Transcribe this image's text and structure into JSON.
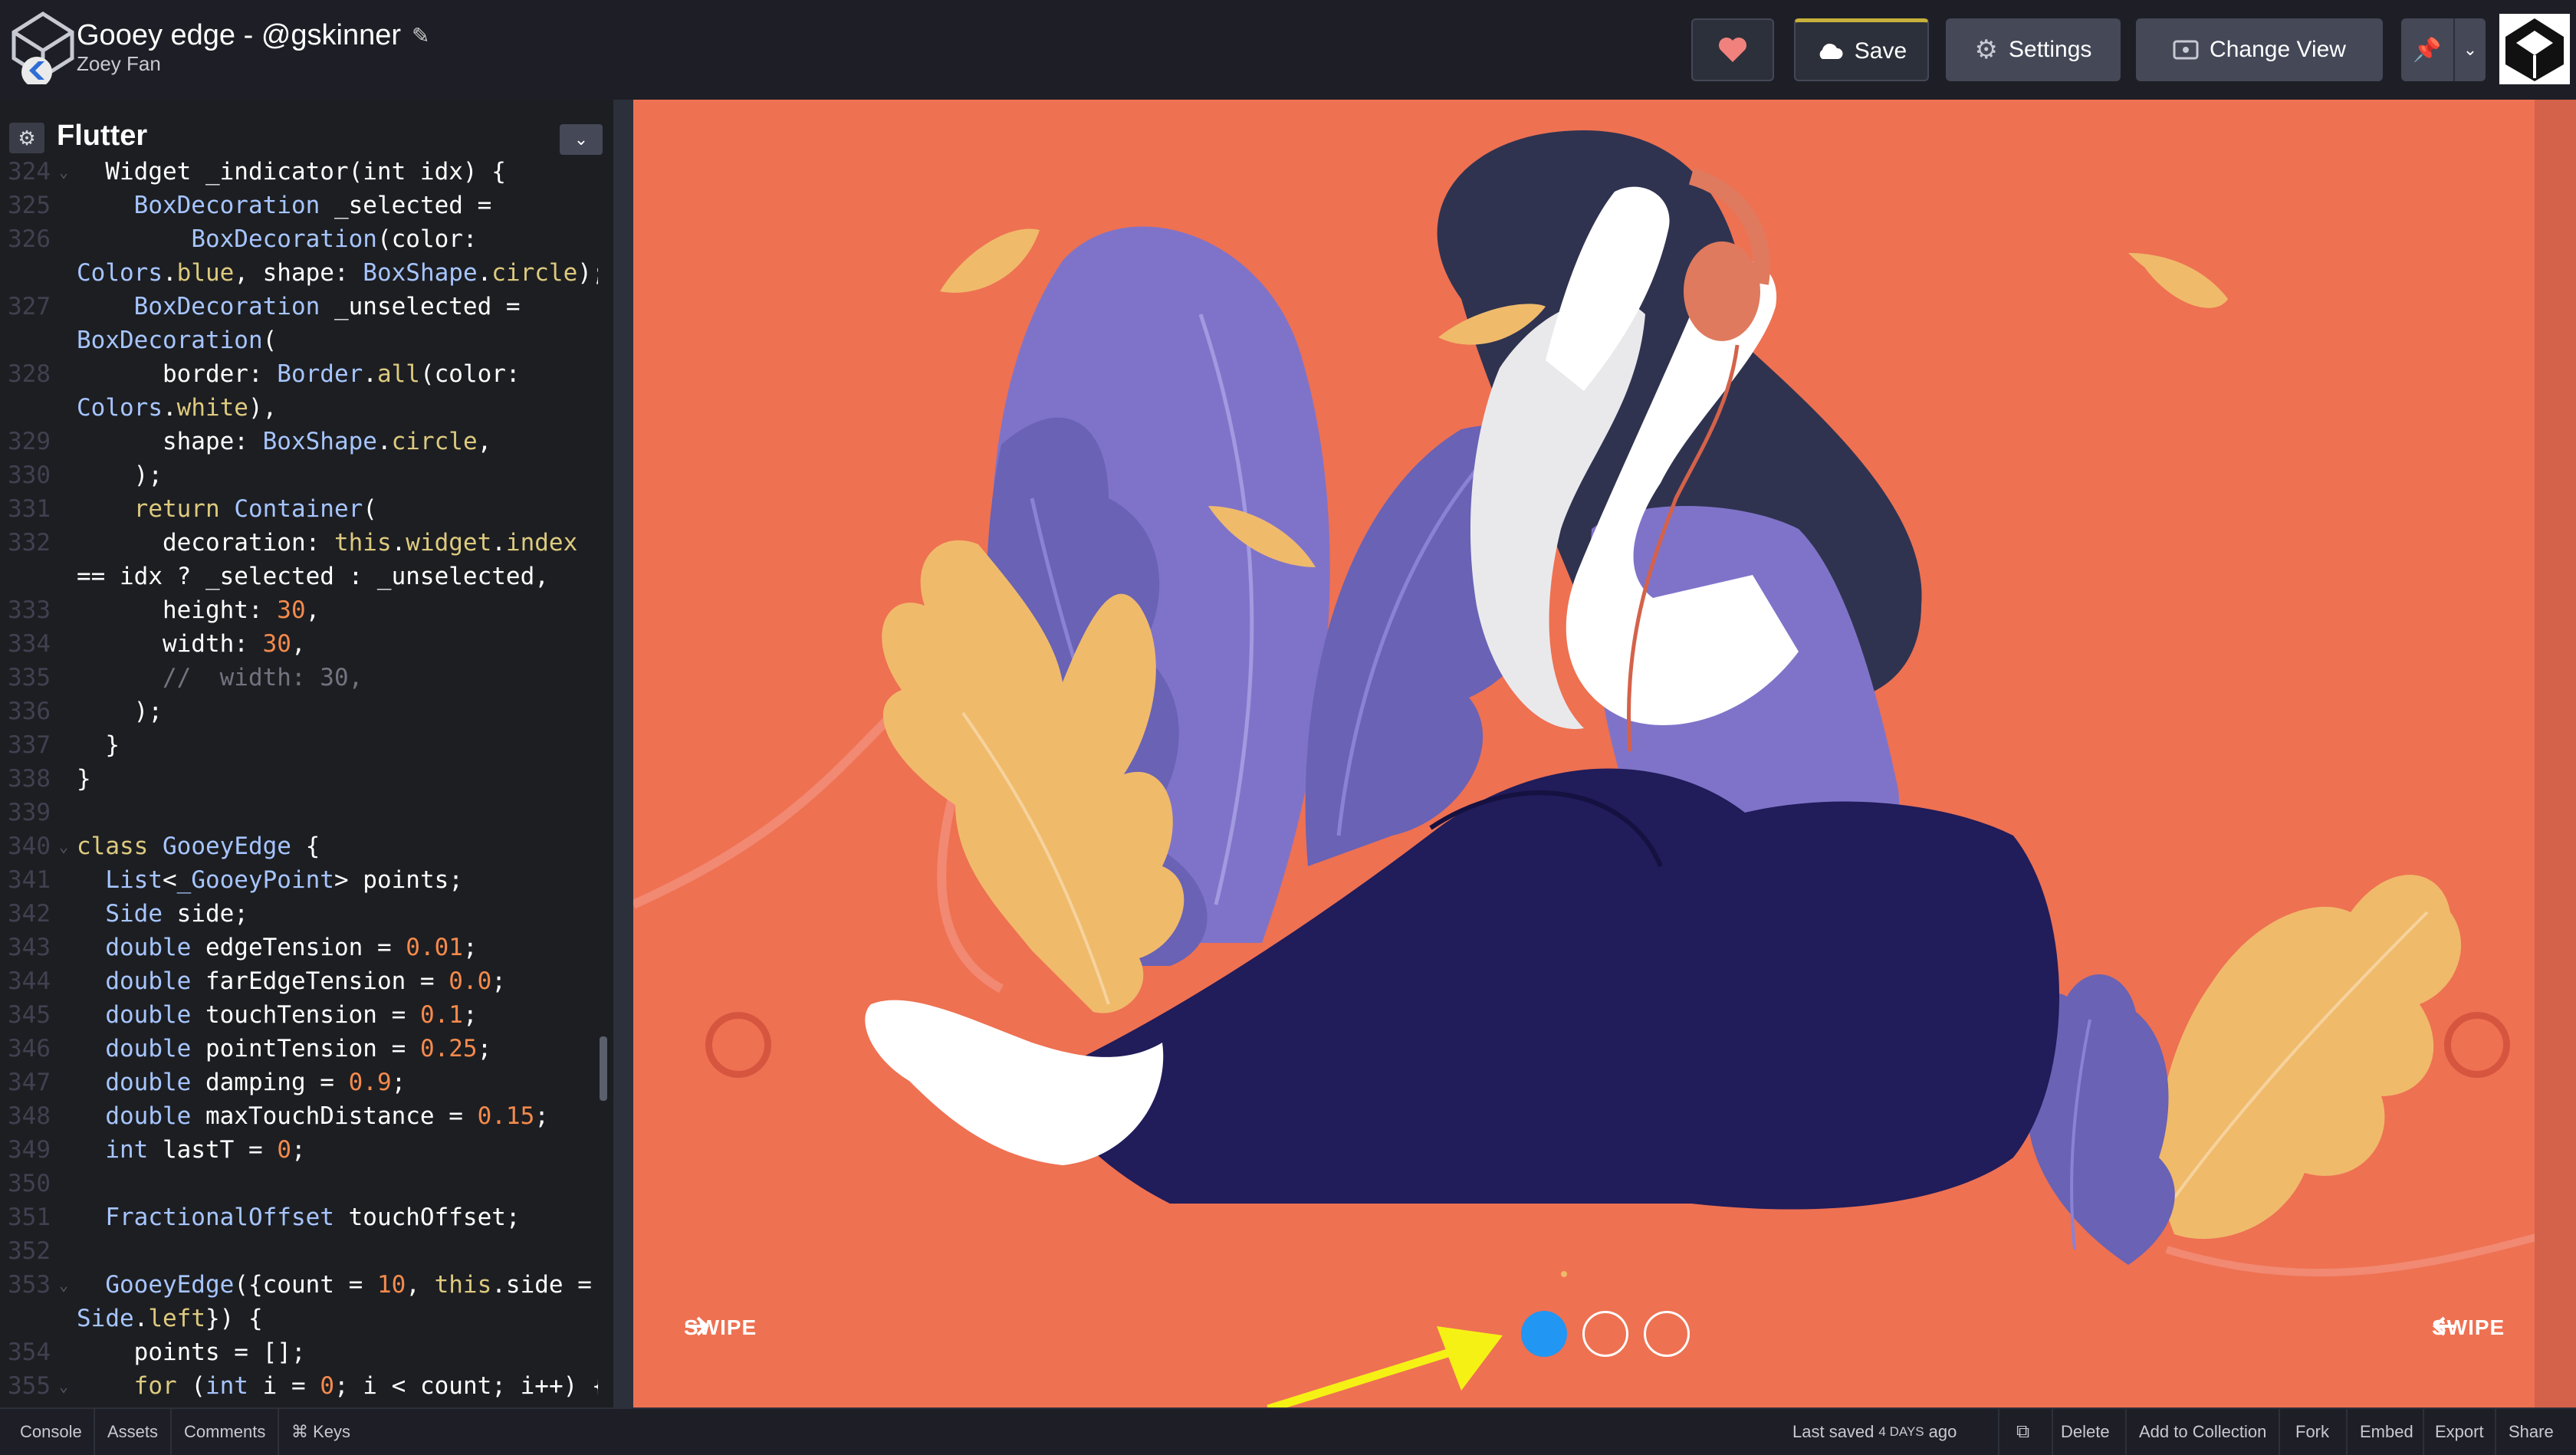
{
  "header": {
    "pen_title": "Gooey edge - @gskinner",
    "author": "Zoey Fan",
    "save_label": "Save",
    "settings_label": "Settings",
    "change_view_label": "Change View"
  },
  "editor": {
    "language": "Flutter",
    "lines": [
      {
        "n": "324",
        "fold": true,
        "parts": [
          [
            "",
            "  Widget _indicator(int idx) {"
          ]
        ]
      },
      {
        "n": "325",
        "parts": [
          [
            "",
            "    "
          ],
          [
            "t",
            "BoxDecoration"
          ],
          [
            "",
            " _selected ="
          ]
        ]
      },
      {
        "n": "326",
        "parts": [
          [
            "",
            "        "
          ],
          [
            "t",
            "BoxDecoration"
          ],
          [
            "",
            "(color:"
          ]
        ]
      },
      {
        "n": "",
        "parts": [
          [
            "t",
            "Colors"
          ],
          [
            "",
            "."
          ],
          [
            "k",
            "blue"
          ],
          [
            "",
            ", shape: "
          ],
          [
            "t",
            "BoxShape"
          ],
          [
            "",
            "."
          ],
          [
            "k",
            "circle"
          ],
          [
            "",
            ");"
          ]
        ]
      },
      {
        "n": "327",
        "parts": [
          [
            "",
            "    "
          ],
          [
            "t",
            "BoxDecoration"
          ],
          [
            "",
            " _unselected ="
          ]
        ]
      },
      {
        "n": "",
        "parts": [
          [
            "t",
            "BoxDecoration"
          ],
          [
            "",
            "("
          ]
        ]
      },
      {
        "n": "328",
        "parts": [
          [
            "",
            "      border: "
          ],
          [
            "t",
            "Border"
          ],
          [
            "",
            "."
          ],
          [
            "k",
            "all"
          ],
          [
            "",
            "(color:"
          ]
        ]
      },
      {
        "n": "",
        "parts": [
          [
            "t",
            "Colors"
          ],
          [
            "",
            "."
          ],
          [
            "k",
            "white"
          ],
          [
            "",
            "),"
          ]
        ]
      },
      {
        "n": "329",
        "parts": [
          [
            "",
            "      shape: "
          ],
          [
            "t",
            "BoxShape"
          ],
          [
            "",
            "."
          ],
          [
            "k",
            "circle"
          ],
          [
            "",
            ","
          ]
        ]
      },
      {
        "n": "330",
        "parts": [
          [
            "",
            "    );"
          ]
        ]
      },
      {
        "n": "331",
        "parts": [
          [
            "",
            "    "
          ],
          [
            "k",
            "return"
          ],
          [
            "",
            " "
          ],
          [
            "t",
            "Container"
          ],
          [
            "",
            "("
          ]
        ]
      },
      {
        "n": "332",
        "parts": [
          [
            "",
            "      decoration: "
          ],
          [
            "k",
            "this"
          ],
          [
            "",
            "."
          ],
          [
            "k",
            "widget"
          ],
          [
            "",
            "."
          ],
          [
            "k",
            "index"
          ]
        ]
      },
      {
        "n": "",
        "parts": [
          [
            "",
            "== idx ? _selected : _unselected,"
          ]
        ]
      },
      {
        "n": "333",
        "parts": [
          [
            "",
            "      height: "
          ],
          [
            "n",
            "30"
          ],
          [
            "",
            ","
          ]
        ]
      },
      {
        "n": "334",
        "parts": [
          [
            "",
            "      width: "
          ],
          [
            "n",
            "30"
          ],
          [
            "",
            ","
          ]
        ]
      },
      {
        "n": "335",
        "parts": [
          [
            "c",
            "      //  width: 30,"
          ]
        ]
      },
      {
        "n": "336",
        "parts": [
          [
            "",
            "    );"
          ]
        ]
      },
      {
        "n": "337",
        "parts": [
          [
            "",
            "  }"
          ]
        ]
      },
      {
        "n": "338",
        "parts": [
          [
            "",
            "}"
          ]
        ]
      },
      {
        "n": "339",
        "parts": [
          [
            "",
            ""
          ]
        ]
      },
      {
        "n": "340",
        "fold": true,
        "parts": [
          [
            "k",
            "class"
          ],
          [
            "",
            " "
          ],
          [
            "t",
            "GooeyEdge"
          ],
          [
            "",
            " {"
          ]
        ]
      },
      {
        "n": "341",
        "parts": [
          [
            "",
            "  "
          ],
          [
            "t",
            "List"
          ],
          [
            "",
            "<"
          ],
          [
            "t",
            "_GooeyPoint"
          ],
          [
            "",
            "> points;"
          ]
        ]
      },
      {
        "n": "342",
        "parts": [
          [
            "",
            "  "
          ],
          [
            "t",
            "Side"
          ],
          [
            "",
            " side;"
          ]
        ]
      },
      {
        "n": "343",
        "parts": [
          [
            "",
            "  "
          ],
          [
            "t",
            "double"
          ],
          [
            "",
            " edgeTension = "
          ],
          [
            "n",
            "0.01"
          ],
          [
            "",
            ";"
          ]
        ]
      },
      {
        "n": "344",
        "parts": [
          [
            "",
            "  "
          ],
          [
            "t",
            "double"
          ],
          [
            "",
            " farEdgeTension = "
          ],
          [
            "n",
            "0.0"
          ],
          [
            "",
            ";"
          ]
        ]
      },
      {
        "n": "345",
        "parts": [
          [
            "",
            "  "
          ],
          [
            "t",
            "double"
          ],
          [
            "",
            " touchTension = "
          ],
          [
            "n",
            "0.1"
          ],
          [
            "",
            ";"
          ]
        ]
      },
      {
        "n": "346",
        "parts": [
          [
            "",
            "  "
          ],
          [
            "t",
            "double"
          ],
          [
            "",
            " pointTension = "
          ],
          [
            "n",
            "0.25"
          ],
          [
            "",
            ";"
          ]
        ]
      },
      {
        "n": "347",
        "parts": [
          [
            "",
            "  "
          ],
          [
            "t",
            "double"
          ],
          [
            "",
            " damping = "
          ],
          [
            "n",
            "0.9"
          ],
          [
            "",
            ";"
          ]
        ]
      },
      {
        "n": "348",
        "parts": [
          [
            "",
            "  "
          ],
          [
            "t",
            "double"
          ],
          [
            "",
            " maxTouchDistance = "
          ],
          [
            "n",
            "0.15"
          ],
          [
            "",
            ";"
          ]
        ]
      },
      {
        "n": "349",
        "parts": [
          [
            "",
            "  "
          ],
          [
            "t",
            "int"
          ],
          [
            "",
            " lastT = "
          ],
          [
            "n",
            "0"
          ],
          [
            "",
            ";"
          ]
        ]
      },
      {
        "n": "350",
        "parts": [
          [
            "",
            ""
          ]
        ]
      },
      {
        "n": "351",
        "parts": [
          [
            "",
            "  "
          ],
          [
            "t",
            "FractionalOffset"
          ],
          [
            "",
            " touchOffset;"
          ]
        ]
      },
      {
        "n": "352",
        "parts": [
          [
            "",
            ""
          ]
        ]
      },
      {
        "n": "353",
        "fold": true,
        "parts": [
          [
            "",
            "  "
          ],
          [
            "t",
            "GooeyEdge"
          ],
          [
            "",
            "({count = "
          ],
          [
            "n",
            "10"
          ],
          [
            "",
            ", "
          ],
          [
            "k",
            "this"
          ],
          [
            "",
            ".side ="
          ]
        ]
      },
      {
        "n": "",
        "parts": [
          [
            "t",
            "Side"
          ],
          [
            "",
            "."
          ],
          [
            "k",
            "left"
          ],
          [
            "",
            "}) {"
          ]
        ]
      },
      {
        "n": "354",
        "parts": [
          [
            "",
            "    points = "
          ],
          [
            "",
            "[]"
          ],
          [
            "",
            ";"
          ]
        ]
      },
      {
        "n": "355",
        "fold": true,
        "parts": [
          [
            "",
            "    "
          ],
          [
            "k",
            "for"
          ],
          [
            "",
            " ("
          ],
          [
            "t",
            "int"
          ],
          [
            "",
            " i = "
          ],
          [
            "n",
            "0"
          ],
          [
            "",
            "; i < count; i++) {"
          ]
        ]
      }
    ]
  },
  "preview": {
    "swipe_left": "SWIPE",
    "swipe_right": "SWIPE",
    "selected_page": 1,
    "page_count": 3,
    "accent_selected": "#2196f3",
    "background": "#ee7152"
  },
  "footer": {
    "console": "Console",
    "assets": "Assets",
    "comments": "Comments",
    "keys": "⌘ Keys",
    "last_saved_prefix": "Last saved",
    "last_saved_ago": "4 DAYS",
    "last_saved_suffix": "ago",
    "delete": "Delete",
    "add_to_collection": "Add to Collection",
    "fork": "Fork",
    "embed": "Embed",
    "export": "Export",
    "share": "Share"
  }
}
